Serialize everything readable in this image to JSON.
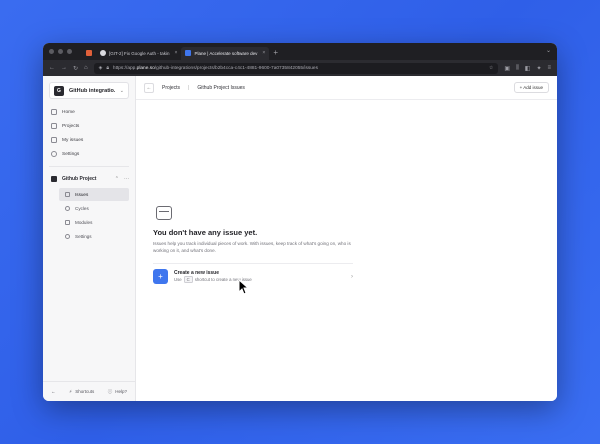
{
  "tabs": [
    {
      "label": "[GIT-2] Fix Google Auth - takin",
      "active": false
    },
    {
      "label": "Plane | Accelerate software dev",
      "active": true
    }
  ],
  "url": {
    "prefix": "https://app.",
    "host": "plane.so",
    "path": "/github-integrations/projects/b2b4cca-c4c1-4881-9600-7a0735842055/issues"
  },
  "sidebar": {
    "workspace": {
      "initial": "G",
      "name": "GitHub integratio..."
    },
    "items": [
      {
        "label": "Home"
      },
      {
        "label": "Projects"
      },
      {
        "label": "My issues"
      },
      {
        "label": "Settings"
      }
    ],
    "project": {
      "name": "Github Project"
    },
    "subitems": [
      {
        "label": "Issues",
        "active": true
      },
      {
        "label": "Cycles",
        "active": false
      },
      {
        "label": "Modules",
        "active": false
      },
      {
        "label": "Settings",
        "active": false
      }
    ],
    "footer": {
      "shortcuts": "Shortcuts",
      "help": "Help?"
    }
  },
  "header": {
    "crumb_projects": "Projects",
    "crumb_current": "Github Project Issues",
    "add_issue": "Add issue"
  },
  "empty": {
    "title": "You don't have any issue yet.",
    "description": "Issues help you track individual pieces of work. With issues, keep track of what's going on, who is working on it, and what's done.",
    "create_title": "Create a new issue",
    "hint_prefix": "Use",
    "hint_key": "C",
    "hint_suffix": "shortcut to create a new issue"
  },
  "colors": {
    "accent": "#3f76ee",
    "background": "#3a6cf0"
  }
}
